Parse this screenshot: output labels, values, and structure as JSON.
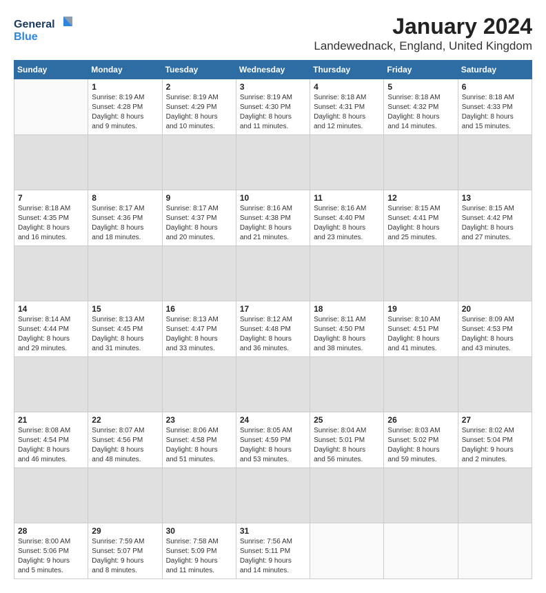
{
  "logo": {
    "line1": "General",
    "line2": "Blue"
  },
  "title": "January 2024",
  "subtitle": "Landewednack, England, United Kingdom",
  "weekdays": [
    "Sunday",
    "Monday",
    "Tuesday",
    "Wednesday",
    "Thursday",
    "Friday",
    "Saturday"
  ],
  "weeks": [
    [
      {
        "day": "",
        "info": ""
      },
      {
        "day": "1",
        "info": "Sunrise: 8:19 AM\nSunset: 4:28 PM\nDaylight: 8 hours\nand 9 minutes."
      },
      {
        "day": "2",
        "info": "Sunrise: 8:19 AM\nSunset: 4:29 PM\nDaylight: 8 hours\nand 10 minutes."
      },
      {
        "day": "3",
        "info": "Sunrise: 8:19 AM\nSunset: 4:30 PM\nDaylight: 8 hours\nand 11 minutes."
      },
      {
        "day": "4",
        "info": "Sunrise: 8:18 AM\nSunset: 4:31 PM\nDaylight: 8 hours\nand 12 minutes."
      },
      {
        "day": "5",
        "info": "Sunrise: 8:18 AM\nSunset: 4:32 PM\nDaylight: 8 hours\nand 14 minutes."
      },
      {
        "day": "6",
        "info": "Sunrise: 8:18 AM\nSunset: 4:33 PM\nDaylight: 8 hours\nand 15 minutes."
      }
    ],
    [
      {
        "day": "7",
        "info": "Sunrise: 8:18 AM\nSunset: 4:35 PM\nDaylight: 8 hours\nand 16 minutes."
      },
      {
        "day": "8",
        "info": "Sunrise: 8:17 AM\nSunset: 4:36 PM\nDaylight: 8 hours\nand 18 minutes."
      },
      {
        "day": "9",
        "info": "Sunrise: 8:17 AM\nSunset: 4:37 PM\nDaylight: 8 hours\nand 20 minutes."
      },
      {
        "day": "10",
        "info": "Sunrise: 8:16 AM\nSunset: 4:38 PM\nDaylight: 8 hours\nand 21 minutes."
      },
      {
        "day": "11",
        "info": "Sunrise: 8:16 AM\nSunset: 4:40 PM\nDaylight: 8 hours\nand 23 minutes."
      },
      {
        "day": "12",
        "info": "Sunrise: 8:15 AM\nSunset: 4:41 PM\nDaylight: 8 hours\nand 25 minutes."
      },
      {
        "day": "13",
        "info": "Sunrise: 8:15 AM\nSunset: 4:42 PM\nDaylight: 8 hours\nand 27 minutes."
      }
    ],
    [
      {
        "day": "14",
        "info": "Sunrise: 8:14 AM\nSunset: 4:44 PM\nDaylight: 8 hours\nand 29 minutes."
      },
      {
        "day": "15",
        "info": "Sunrise: 8:13 AM\nSunset: 4:45 PM\nDaylight: 8 hours\nand 31 minutes."
      },
      {
        "day": "16",
        "info": "Sunrise: 8:13 AM\nSunset: 4:47 PM\nDaylight: 8 hours\nand 33 minutes."
      },
      {
        "day": "17",
        "info": "Sunrise: 8:12 AM\nSunset: 4:48 PM\nDaylight: 8 hours\nand 36 minutes."
      },
      {
        "day": "18",
        "info": "Sunrise: 8:11 AM\nSunset: 4:50 PM\nDaylight: 8 hours\nand 38 minutes."
      },
      {
        "day": "19",
        "info": "Sunrise: 8:10 AM\nSunset: 4:51 PM\nDaylight: 8 hours\nand 41 minutes."
      },
      {
        "day": "20",
        "info": "Sunrise: 8:09 AM\nSunset: 4:53 PM\nDaylight: 8 hours\nand 43 minutes."
      }
    ],
    [
      {
        "day": "21",
        "info": "Sunrise: 8:08 AM\nSunset: 4:54 PM\nDaylight: 8 hours\nand 46 minutes."
      },
      {
        "day": "22",
        "info": "Sunrise: 8:07 AM\nSunset: 4:56 PM\nDaylight: 8 hours\nand 48 minutes."
      },
      {
        "day": "23",
        "info": "Sunrise: 8:06 AM\nSunset: 4:58 PM\nDaylight: 8 hours\nand 51 minutes."
      },
      {
        "day": "24",
        "info": "Sunrise: 8:05 AM\nSunset: 4:59 PM\nDaylight: 8 hours\nand 53 minutes."
      },
      {
        "day": "25",
        "info": "Sunrise: 8:04 AM\nSunset: 5:01 PM\nDaylight: 8 hours\nand 56 minutes."
      },
      {
        "day": "26",
        "info": "Sunrise: 8:03 AM\nSunset: 5:02 PM\nDaylight: 8 hours\nand 59 minutes."
      },
      {
        "day": "27",
        "info": "Sunrise: 8:02 AM\nSunset: 5:04 PM\nDaylight: 9 hours\nand 2 minutes."
      }
    ],
    [
      {
        "day": "28",
        "info": "Sunrise: 8:00 AM\nSunset: 5:06 PM\nDaylight: 9 hours\nand 5 minutes."
      },
      {
        "day": "29",
        "info": "Sunrise: 7:59 AM\nSunset: 5:07 PM\nDaylight: 9 hours\nand 8 minutes."
      },
      {
        "day": "30",
        "info": "Sunrise: 7:58 AM\nSunset: 5:09 PM\nDaylight: 9 hours\nand 11 minutes."
      },
      {
        "day": "31",
        "info": "Sunrise: 7:56 AM\nSunset: 5:11 PM\nDaylight: 9 hours\nand 14 minutes."
      },
      {
        "day": "",
        "info": ""
      },
      {
        "day": "",
        "info": ""
      },
      {
        "day": "",
        "info": ""
      }
    ]
  ]
}
